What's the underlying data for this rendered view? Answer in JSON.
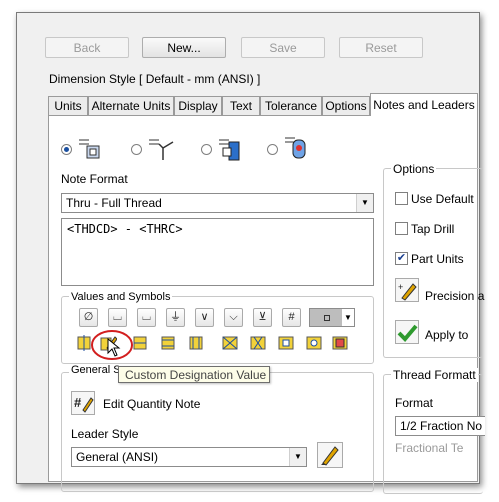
{
  "toolbar": {
    "back": "Back",
    "new": "New...",
    "save": "Save",
    "reset": "Reset"
  },
  "dimension_style": "Dimension Style [ Default - mm (ANSI) ]",
  "tabs": [
    "Units",
    "Alternate Units",
    "Display",
    "Text",
    "Tolerance",
    "Options",
    "Notes and Leaders"
  ],
  "note_format": {
    "label": "Note Format",
    "selected": "Thru - Full Thread",
    "text": "<THDCD> - <THRC>"
  },
  "values_symbols": {
    "label": "Values and Symbols",
    "top_row": [
      "∅",
      "⌴",
      "⌴",
      "⏚",
      "∨",
      "⌵",
      "⊻",
      "#"
    ]
  },
  "tooltip": "Custom Designation Value",
  "general_settings": {
    "label": "General Se",
    "edit_quantity": "Edit Quantity Note"
  },
  "leader_style": {
    "label": "Leader Style",
    "selected": "General (ANSI)"
  },
  "options": {
    "label": "Options",
    "use_default": "Use Default",
    "tap_drill": "Tap Drill",
    "part_units": "Part Units",
    "precision": "Precision a",
    "apply": "Apply to"
  },
  "thread_format": {
    "label": "Thread Formatt",
    "format_label": "Format",
    "format_value": "1/2 Fraction No",
    "fractional": "Fractional Te"
  }
}
